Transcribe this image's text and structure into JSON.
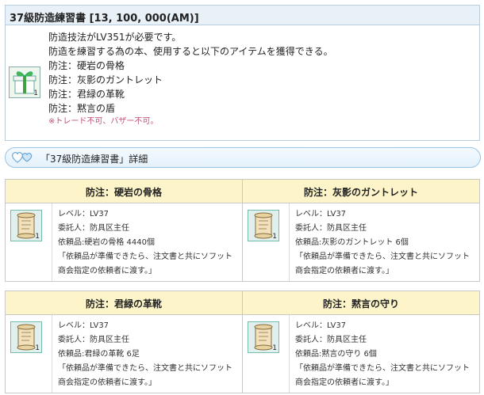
{
  "item": {
    "title": "37級防造練習書 [13, 100, 000(AM)]",
    "icon": "gift-box-icon",
    "count": "1",
    "lines": [
      "防造技法がLV351が必要です。",
      "防造を練習する為の本、使用すると以下のアイテムを獲得できる。",
      "防注：硬岩の骨格",
      "防注：灰影のガントレット",
      "防注：君緑の革靴",
      "防注：黙言の盾"
    ],
    "note": "※トレード不可、バザー不可。"
  },
  "section": {
    "label": "「37級防造練習書」詳細",
    "icon": "hearts-icon"
  },
  "recipes": [
    {
      "title": "防注：硬岩の骨格",
      "icon": "scroll-icon",
      "count": "1",
      "level": "レベル：LV37",
      "client": "委託人：防具区主任",
      "request": "依頼品:硬岩の骨格 4440個",
      "quote1": "「依頼品が準備できたら、注文書と共にソフット",
      "quote2": "商会指定の依頼者に渡す。」"
    },
    {
      "title": "防注：灰影のガントレット",
      "icon": "scroll-icon",
      "count": "1",
      "level": "レベル：LV37",
      "client": "委託人：防具区主任",
      "request": "依頼品:灰影のガントレット 6個",
      "quote1": "「依頼品が準備できたら、注文書と共にソフット",
      "quote2": "商会指定の依頼者に渡す。」"
    },
    {
      "title": "防注：君緑の革靴",
      "icon": "scroll-icon",
      "count": "1",
      "level": "レベル：LV37",
      "client": "委託人：防具区主任",
      "request": "依頼品:君緑の革靴 6足",
      "quote1": "「依頼品が準備できたら、注文書と共にソフット",
      "quote2": "商会指定の依頼者に渡す。」"
    },
    {
      "title": "防注：黙言の守り",
      "icon": "scroll-icon",
      "count": "1",
      "level": "レベル：LV37",
      "client": "委託人：防具区主任",
      "request": "依頼品:黙言の守り 6個",
      "quote1": "「依頼品が準備できたら、注文書と共にソフット",
      "quote2": "商会指定の依頼者に渡す。」"
    }
  ],
  "colors": {
    "title_bg": "#e8f0f8",
    "section_border": "#9ac4e4",
    "recipe_head_bg": "#fdf5c9",
    "note_text": "#c0507a"
  }
}
